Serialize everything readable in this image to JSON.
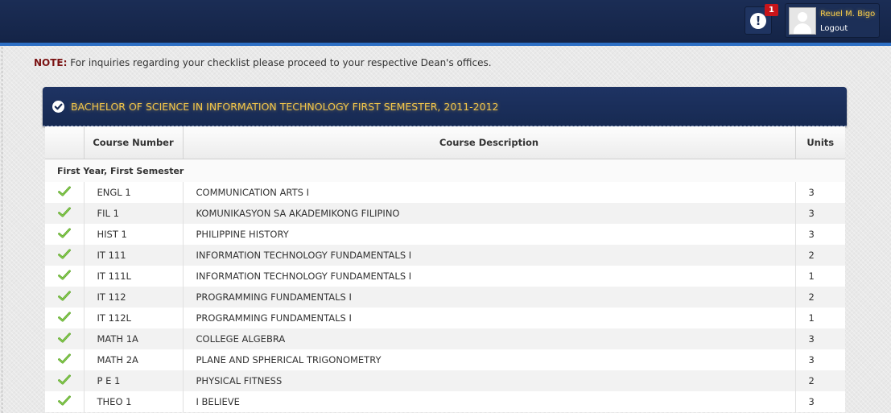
{
  "header": {
    "notification_count": "1",
    "user_name": "Reuel M. Bigo",
    "logout_label": "Logout"
  },
  "note": {
    "label": "NOTE:",
    "text": " For inquiries regarding your checklist please proceed to your respective Dean's offices."
  },
  "program": {
    "title": "BACHELOR OF SCIENCE IN INFORMATION TECHNOLOGY FIRST SEMESTER, 2011-2012"
  },
  "table": {
    "columns": [
      "",
      "Course Number",
      "Course Description",
      "Units"
    ],
    "group_label": "First Year, First Semester",
    "rows": [
      {
        "number": "ENGL 1",
        "description": "COMMUNICATION ARTS I",
        "units": "3"
      },
      {
        "number": "FIL 1",
        "description": "KOMUNIKASYON SA AKADEMIKONG FILIPINO",
        "units": "3"
      },
      {
        "number": "HIST 1",
        "description": "PHILIPPINE HISTORY",
        "units": "3"
      },
      {
        "number": "IT 111",
        "description": "INFORMATION TECHNOLOGY FUNDAMENTALS I",
        "units": "2"
      },
      {
        "number": "IT 111L",
        "description": "INFORMATION TECHNOLOGY FUNDAMENTALS I",
        "units": "1"
      },
      {
        "number": "IT 112",
        "description": "PROGRAMMING FUNDAMENTALS I",
        "units": "2"
      },
      {
        "number": "IT 112L",
        "description": "PROGRAMMING FUNDAMENTALS I",
        "units": "1"
      },
      {
        "number": "MATH 1A",
        "description": "COLLEGE ALGEBRA",
        "units": "3"
      },
      {
        "number": "MATH 2A",
        "description": "PLANE AND SPHERICAL TRIGONOMETRY",
        "units": "3"
      },
      {
        "number": "P E 1",
        "description": "PHYSICAL FITNESS",
        "units": "2"
      },
      {
        "number": "THEO 1",
        "description": "I BELIEVE",
        "units": "3"
      }
    ]
  },
  "colors": {
    "header_bg": "#172a52",
    "accent_blue": "#2d6fc4",
    "title_gold": "#f3c64a",
    "check_green": "#5fa82a",
    "badge_red": "#c8141a"
  },
  "icons": {
    "notification": "exclamation-circle-icon",
    "title": "check-circle-icon",
    "row_status": "green-check-icon"
  }
}
